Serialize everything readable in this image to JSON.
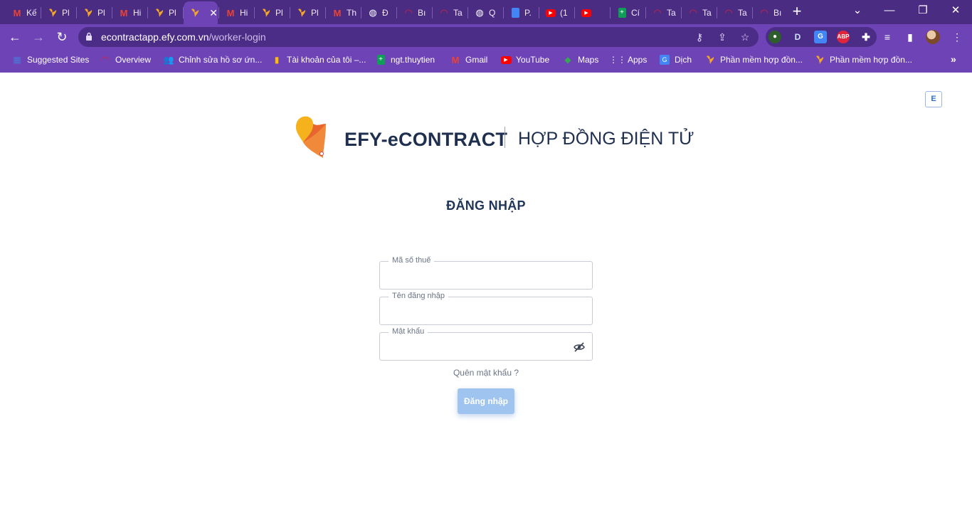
{
  "browser": {
    "tabs": [
      {
        "icon": "gmail-icon",
        "label": "Kế"
      },
      {
        "icon": "efy-icon",
        "label": "Pl"
      },
      {
        "icon": "efy-icon",
        "label": "Pl"
      },
      {
        "icon": "gmail-icon",
        "label": "Hi"
      },
      {
        "icon": "efy-icon",
        "label": "Pl"
      },
      {
        "icon": "efy-icon",
        "label": "",
        "active": true
      },
      {
        "icon": "gmail-icon",
        "label": "Hi"
      },
      {
        "icon": "efy-icon",
        "label": "Pl"
      },
      {
        "icon": "efy-icon",
        "label": "Pl"
      },
      {
        "icon": "gmail-icon",
        "label": "Th"
      },
      {
        "icon": "globe-icon",
        "label": "Đ"
      },
      {
        "icon": "arc-icon",
        "label": "Bı"
      },
      {
        "icon": "arc-icon",
        "label": "Ta"
      },
      {
        "icon": "globe-icon",
        "label": "Q"
      },
      {
        "icon": "docs-icon",
        "label": "P."
      },
      {
        "icon": "youtube-icon",
        "label": "(1"
      },
      {
        "icon": "youtube-icon",
        "label": ""
      },
      {
        "icon": "sheets-icon",
        "label": "Cí"
      },
      {
        "icon": "arc-icon",
        "label": "Ta"
      },
      {
        "icon": "arc-icon",
        "label": "Ta"
      },
      {
        "icon": "arc-icon",
        "label": "Ta"
      },
      {
        "icon": "arc-icon",
        "label": "Bı"
      }
    ],
    "address": {
      "domain": "econtractapp.efy.com.vn",
      "path": "/worker-login"
    },
    "bookmarks": [
      {
        "icon": "grid-icon",
        "label": "Suggested Sites"
      },
      {
        "icon": "arc-icon",
        "label": "Overview"
      },
      {
        "icon": "people-icon",
        "label": "Chỉnh sửa hồ sơ ứn..."
      },
      {
        "icon": "bars-icon",
        "label": "Tài khoản của tôi –..."
      },
      {
        "icon": "sheets-icon",
        "label": "ngt.thuytien"
      },
      {
        "icon": "gmail-icon",
        "label": "Gmail"
      },
      {
        "icon": "youtube-icon",
        "label": "YouTube"
      },
      {
        "icon": "maps-icon",
        "label": "Maps"
      },
      {
        "icon": "apps-icon",
        "label": "Apps"
      },
      {
        "icon": "translate-icon",
        "label": "Dịch"
      },
      {
        "icon": "efy-icon",
        "label": "Phần mềm hợp đồn..."
      },
      {
        "icon": "efy-icon",
        "label": "Phần mềm hợp đồn..."
      }
    ]
  },
  "page": {
    "language_button": "E",
    "brand": {
      "name": "EFY-eCONTRACT",
      "tagline": "HỢP ĐỒNG ĐIỆN TỬ"
    },
    "login": {
      "title": "ĐĂNG NHẬP",
      "tax_code_label": "Mã số thuế",
      "tax_code_value": "",
      "username_label": "Tên đăng nhập",
      "username_value": "",
      "password_label": "Mật khẩu",
      "password_value": "",
      "forgot_password": "Quên mật khẩu ?",
      "submit_label": "Đăng nhập"
    },
    "colors": {
      "chrome_dark": "#4a2c82",
      "chrome": "#6d43b5",
      "brand_text": "#1f2f4f",
      "button_disabled": "#9fc4ef"
    }
  }
}
